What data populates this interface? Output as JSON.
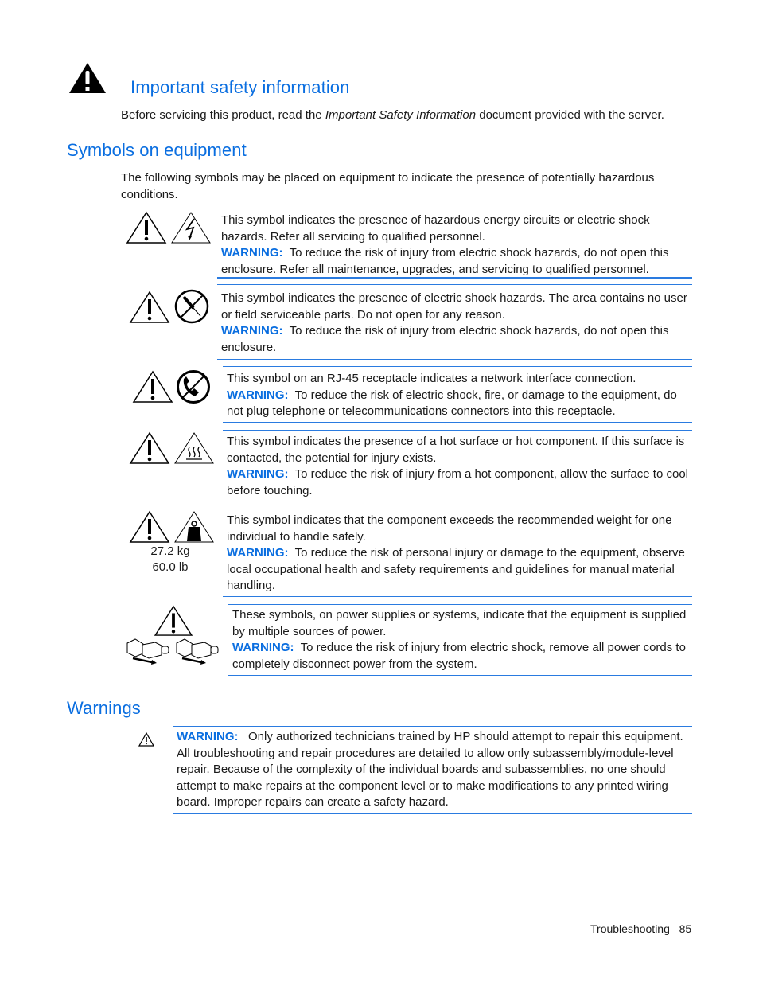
{
  "important": {
    "title": "Important safety information",
    "icon": "warning-triangle-filled-icon",
    "text_pre": "Before servicing this product, read the ",
    "text_italic": "Important Safety Information",
    "text_post": " document provided with the server."
  },
  "symbols": {
    "title": "Symbols on equipment",
    "intro": "The following symbols may be placed on equipment to indicate the presence of potentially hazardous conditions.",
    "warning_label": "WARNING:",
    "items": [
      {
        "icons": [
          "caution-triangle-icon",
          "electric-shock-triangle-icon"
        ],
        "description": "This symbol indicates the presence of hazardous energy circuits or electric shock hazards. Refer all servicing to qualified personnel.",
        "warning": "To reduce the risk of injury from electric shock hazards, do not open this enclosure. Refer all maintenance, upgrades, and servicing to qualified personnel."
      },
      {
        "icons": [
          "caution-triangle-icon",
          "no-tools-icon"
        ],
        "description": "This symbol indicates the presence of electric shock hazards. The area contains no user or field serviceable parts. Do not open for any reason.",
        "warning": "To reduce the risk of injury from electric shock hazards, do not open this enclosure."
      },
      {
        "icons": [
          "caution-triangle-icon",
          "no-telephone-icon"
        ],
        "description": "This symbol on an RJ-45 receptacle indicates a network interface connection.",
        "warning": "To reduce the risk of electric shock, fire, or damage to the equipment, do not plug telephone or telecommunications connectors into this receptacle."
      },
      {
        "icons": [
          "caution-triangle-icon",
          "hot-surface-icon"
        ],
        "description": "This symbol indicates the presence of a hot surface or hot component. If this surface is contacted, the potential for injury exists.",
        "warning": "To reduce the risk of injury from a hot component, allow the surface to cool before touching."
      },
      {
        "icons": [
          "caution-triangle-icon",
          "heavy-weight-icon"
        ],
        "weight_kg": "27.2 kg",
        "weight_lb": "60.0 lb",
        "description": "This symbol indicates that the component exceeds the recommended weight for one individual to handle safely.",
        "warning": "To reduce the risk of personal injury or damage to the equipment, observe local occupational health and safety requirements and guidelines for manual material handling."
      },
      {
        "icons": [
          "caution-triangle-icon",
          "power-cord-unplug-icon",
          "power-cord-unplug-icon"
        ],
        "description": "These symbols, on power supplies or systems, indicate that the equipment is supplied by multiple sources of power.",
        "warning": "To reduce the risk of injury from electric shock, remove all power cords to completely disconnect power from the system."
      }
    ]
  },
  "warnings": {
    "title": "Warnings",
    "label": "WARNING:",
    "text": "Only authorized technicians trained by HP should attempt to repair this equipment. All troubleshooting and repair procedures are detailed to allow only subassembly/module-level repair. Because of the complexity of the individual boards and subassemblies, no one should attempt to make repairs at the component level or to make modifications to any printed wiring board. Improper repairs can create a safety hazard."
  },
  "footer": {
    "section": "Troubleshooting",
    "page": "85"
  },
  "colors": {
    "accent": "#0a6ee0",
    "rule": "#2a7be0"
  }
}
